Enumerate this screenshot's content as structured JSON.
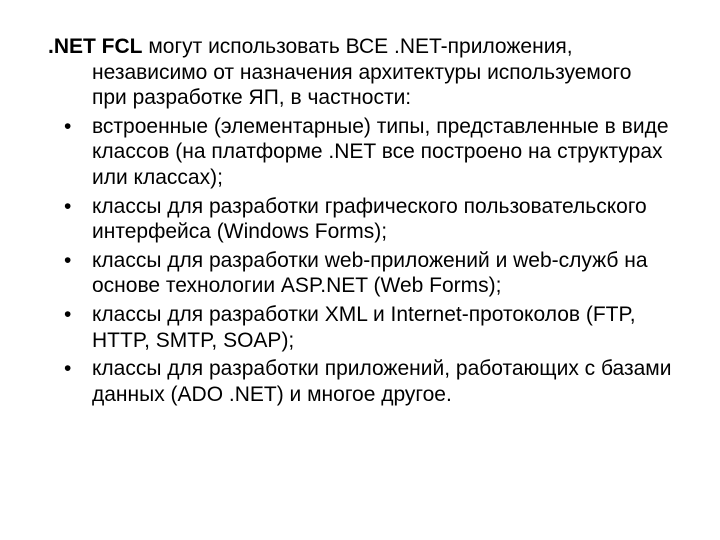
{
  "slide": {
    "intro_bold": ".NET FCL",
    "intro_rest": " могут использовать ВСЕ .NET-приложения, независимо от назначения архитектуры используемого при разработке ЯП, в частности:",
    "bullets": [
      "встроенные (элементарные) типы, представленные в виде классов (на платформе .NET все построено на структурах или классах);",
      "классы для разработки графического пользовательского интерфейса (Windows Forms);",
      "классы для разработки web-приложений и web-служб на основе технологии ASP.NET (Web Forms);",
      "классы для разработки XML и Internet-протоколов (FTP, HTTP, SMTP, SOAP);",
      "классы для разработки приложений, работающих с базами данных (ADO .NET) и многое другое."
    ]
  }
}
